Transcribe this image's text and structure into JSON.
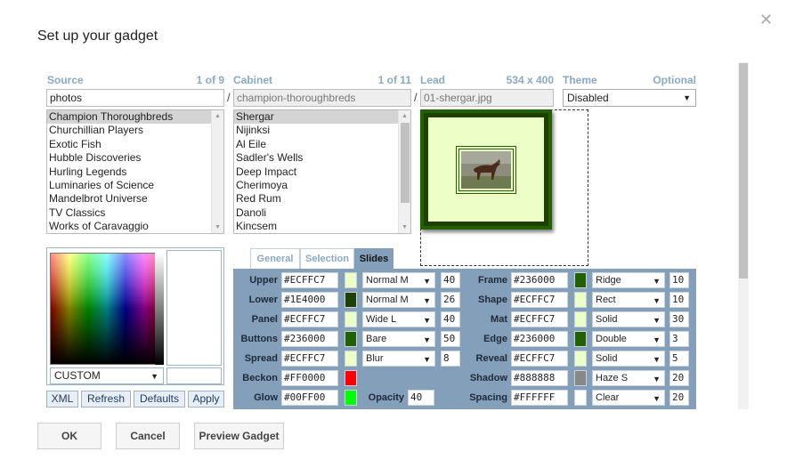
{
  "dialog": {
    "title": "Set up your gadget"
  },
  "source": {
    "label": "Source",
    "count": "1 of 9",
    "value": "photos",
    "items": [
      "Champion Thoroughbreds",
      "Churchillian Players",
      "Exotic Fish",
      "Hubble Discoveries",
      "Hurling Legends",
      "Luminaries of Science",
      "Mandelbrot Universe",
      "TV Classics",
      "Works of Caravaggio"
    ]
  },
  "cabinet": {
    "label": "Cabinet",
    "count": "1 of 11",
    "value": "champion-thoroughbreds",
    "items": [
      "Shergar",
      "Nijinksi",
      "Al Eile",
      "Sadler's Wells",
      "Deep Impact",
      "Cherimoya",
      "Red Rum",
      "Danoli",
      "Kincsem"
    ]
  },
  "lead": {
    "label": "Lead",
    "size": "534 x 400",
    "value": "01-shergar.jpg"
  },
  "theme": {
    "label": "Theme",
    "optional": "Optional",
    "value": "Disabled"
  },
  "separator": "/",
  "picker": {
    "mode": "CUSTOM"
  },
  "side_buttons": {
    "xml": "XML",
    "refresh": "Refresh",
    "defaults": "Defaults",
    "apply": "Apply"
  },
  "tabs": {
    "general": "General",
    "selection": "Selection",
    "slides": "Slides"
  },
  "rows_left": [
    {
      "label": "Upper",
      "hex": "#ECFFC7",
      "color": "#ECFFC7",
      "mode": "Normal M",
      "num": "40"
    },
    {
      "label": "Lower",
      "hex": "#1E4000",
      "color": "#1E4000",
      "mode": "Normal M",
      "num": "26"
    },
    {
      "label": "Panel",
      "hex": "#ECFFC7",
      "color": "#ECFFC7",
      "mode": "Wide L",
      "num": "40"
    },
    {
      "label": "Buttons",
      "hex": "#236000",
      "color": "#236000",
      "mode": "Bare",
      "num": "50"
    },
    {
      "label": "Spread",
      "hex": "#ECFFC7",
      "color": "#ECFFC7",
      "mode": "Blur",
      "num": "8"
    },
    {
      "label": "Beckon",
      "hex": "#FF0000",
      "color": "#FF0000"
    },
    {
      "label": "Glow",
      "hex": "#00FF00",
      "color": "#00FF00"
    }
  ],
  "opacity": {
    "label": "Opacity",
    "value": "40"
  },
  "rows_right": [
    {
      "label": "Frame",
      "hex": "#236000",
      "color": "#236000",
      "mode": "Ridge",
      "num": "10"
    },
    {
      "label": "Shape",
      "hex": "#ECFFC7",
      "color": "#ECFFC7",
      "mode": "Rect",
      "num": "10"
    },
    {
      "label": "Mat",
      "hex": "#ECFFC7",
      "color": "#ECFFC7",
      "mode": "Solid",
      "num": "30"
    },
    {
      "label": "Edge",
      "hex": "#236000",
      "color": "#236000",
      "mode": "Double",
      "num": "3"
    },
    {
      "label": "Reveal",
      "hex": "#ECFFC7",
      "color": "#ECFFC7",
      "mode": "Solid",
      "num": "5"
    },
    {
      "label": "Shadow",
      "hex": "#888888",
      "color": "#888888",
      "mode": "Haze S",
      "num": "20"
    },
    {
      "label": "Spacing",
      "hex": "#FFFFFF",
      "color": "#FFFFFF",
      "mode": "Clear",
      "num": "20"
    }
  ],
  "footer": {
    "ok": "OK",
    "cancel": "Cancel",
    "preview": "Preview Gadget"
  },
  "colors": {
    "accent_label": "#8aa9c4",
    "panel": "#839fb9"
  }
}
